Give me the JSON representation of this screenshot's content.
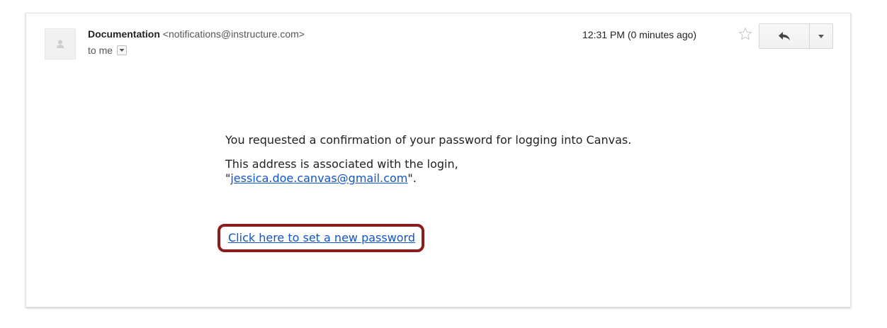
{
  "header": {
    "sender_name": "Documentation",
    "sender_email": "<notifications@instructure.com>",
    "recipient_label": "to me",
    "timestamp": "12:31 PM (0 minutes ago)"
  },
  "icons": {
    "avatar": "person-icon",
    "recipient_dropdown": "chevron-down-icon",
    "star": "star-icon",
    "reply": "reply-icon",
    "more": "caret-down-icon"
  },
  "body": {
    "paragraph_1": "You requested a confirmation of your password for logging into Canvas.",
    "paragraph_2_prefix": "This address is associated with the login,",
    "paragraph_2_quote_open": "\"",
    "paragraph_2_link": "jessica.doe.canvas@gmail.com",
    "paragraph_2_quote_close": "\".",
    "reset_link": "Click here to set a new password"
  },
  "colors": {
    "link": "#1155cc",
    "highlight_border": "#8a1e1e"
  }
}
